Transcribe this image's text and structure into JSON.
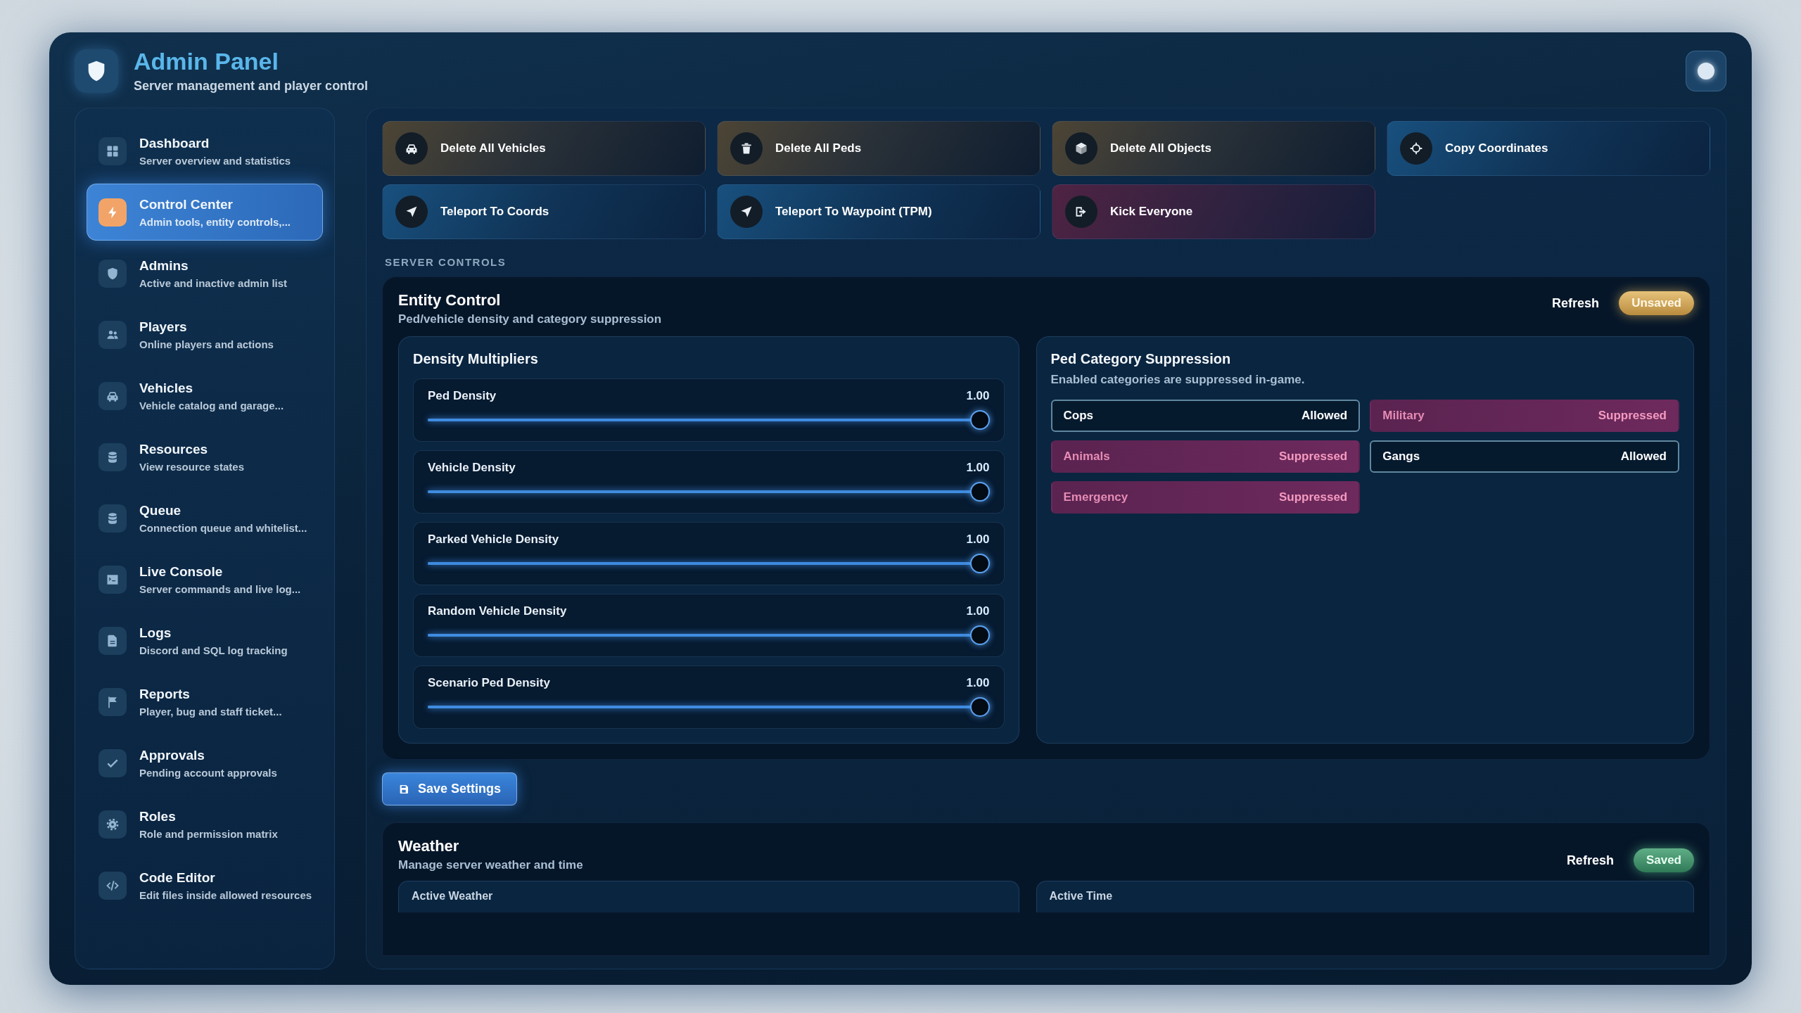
{
  "window": {
    "title": "Admin Panel",
    "subtitle": "Server management and player control"
  },
  "sidebar": {
    "items": [
      {
        "title": "Dashboard",
        "subtitle": "Server overview and statistics",
        "selected": false
      },
      {
        "title": "Control Center",
        "subtitle": "Admin tools, entity controls,...",
        "selected": true
      },
      {
        "title": "Admins",
        "subtitle": "Active and inactive admin list",
        "selected": false
      },
      {
        "title": "Players",
        "subtitle": "Online players and actions",
        "selected": false
      },
      {
        "title": "Vehicles",
        "subtitle": "Vehicle catalog and garage...",
        "selected": false
      },
      {
        "title": "Resources",
        "subtitle": "View resource states",
        "selected": false
      },
      {
        "title": "Queue",
        "subtitle": "Connection queue and whitelist...",
        "selected": false
      },
      {
        "title": "Live Console",
        "subtitle": "Server commands and live log...",
        "selected": false
      },
      {
        "title": "Logs",
        "subtitle": "Discord and SQL log tracking",
        "selected": false
      },
      {
        "title": "Reports",
        "subtitle": "Player, bug and staff ticket...",
        "selected": false
      },
      {
        "title": "Approvals",
        "subtitle": "Pending account approvals",
        "selected": false
      },
      {
        "title": "Roles",
        "subtitle": "Role and permission matrix",
        "selected": false
      },
      {
        "title": "Code Editor",
        "subtitle": "Edit files inside allowed resources",
        "selected": false
      }
    ]
  },
  "actions": [
    {
      "label": "Delete All Vehicles",
      "kind": "destructive"
    },
    {
      "label": "Delete All Peds",
      "kind": "destructive"
    },
    {
      "label": "Delete All Objects",
      "kind": "destructive"
    },
    {
      "label": "Copy Coordinates",
      "kind": "utility"
    },
    {
      "label": "Teleport To Coords",
      "kind": "utility"
    },
    {
      "label": "Teleport To Waypoint (TPM)",
      "kind": "utility"
    },
    {
      "label": "Kick Everyone",
      "kind": "moderation"
    }
  ],
  "section_label": "SERVER CONTROLS",
  "entity_control": {
    "title": "Entity Control",
    "subtitle": "Ped/vehicle density and category suppression",
    "refresh": "Refresh",
    "status": {
      "label": "Unsaved",
      "kind": "unsaved"
    },
    "density": {
      "title": "Density Multipliers",
      "sliders": [
        {
          "label": "Ped Density",
          "reading": "1.00",
          "level": 1
        },
        {
          "label": "Vehicle Density",
          "reading": "1.00",
          "level": 1
        },
        {
          "label": "Parked Vehicle Density",
          "reading": "1.00",
          "level": 1
        },
        {
          "label": "Random Vehicle Density",
          "reading": "1.00",
          "level": 1
        },
        {
          "label": "Scenario Ped Density",
          "reading": "1.00",
          "level": 1
        }
      ]
    },
    "suppression": {
      "title": "Ped Category Suppression",
      "subtitle": "Enabled categories are suppressed in-game.",
      "categories": [
        {
          "name": "Cops",
          "state": "Allowed",
          "suppressed": false
        },
        {
          "name": "Military",
          "state": "Suppressed",
          "suppressed": true
        },
        {
          "name": "Animals",
          "state": "Suppressed",
          "suppressed": true
        },
        {
          "name": "Gangs",
          "state": "Allowed",
          "suppressed": false
        },
        {
          "name": "Emergency",
          "state": "Suppressed",
          "suppressed": true
        }
      ]
    }
  },
  "save_button": "Save Settings",
  "weather": {
    "title": "Weather",
    "subtitle": "Manage server weather and time",
    "refresh": "Refresh",
    "status": {
      "label": "Saved",
      "kind": "saved"
    },
    "panels": [
      "Active Weather",
      "Active Time"
    ]
  }
}
